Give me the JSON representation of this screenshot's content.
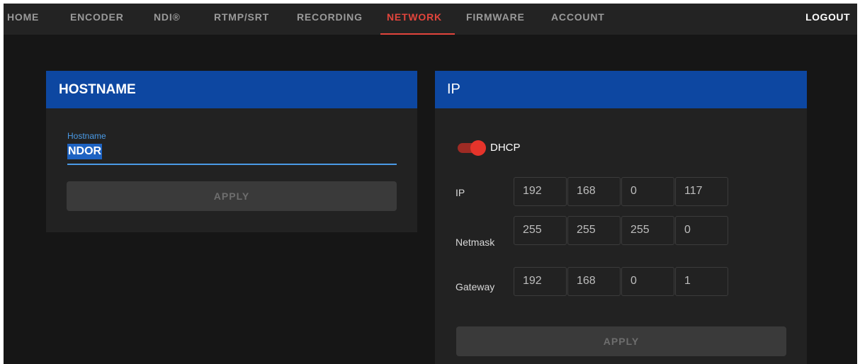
{
  "nav": {
    "items": [
      {
        "label": "HOME"
      },
      {
        "label": "ENCODER"
      },
      {
        "label": "NDI®"
      },
      {
        "label": "RTMP/SRT"
      },
      {
        "label": "RECORDING"
      },
      {
        "label": "NETWORK",
        "active": true
      },
      {
        "label": "FIRMWARE"
      },
      {
        "label": "ACCOUNT"
      }
    ],
    "logout_label": "LOGOUT"
  },
  "hostname_card": {
    "title": "HOSTNAME",
    "field_label": "Hostname",
    "field_value": "NDOR",
    "apply_label": "APPLY"
  },
  "ip_card": {
    "title": "IP",
    "dhcp_label": "DHCP",
    "dhcp_enabled": true,
    "rows": [
      {
        "label": "IP",
        "octets": [
          "192",
          "168",
          "0",
          "117"
        ]
      },
      {
        "label": "Netmask",
        "octets": [
          "255",
          "255",
          "255",
          "0"
        ]
      },
      {
        "label": "Gateway",
        "octets": [
          "192",
          "168",
          "0",
          "1"
        ]
      }
    ],
    "apply_label": "APPLY"
  },
  "colors": {
    "accent_active": "#e2453c",
    "header_blue": "#0d47a1",
    "field_focus": "#4a9ae6",
    "toggle_on": "#e5342b"
  }
}
